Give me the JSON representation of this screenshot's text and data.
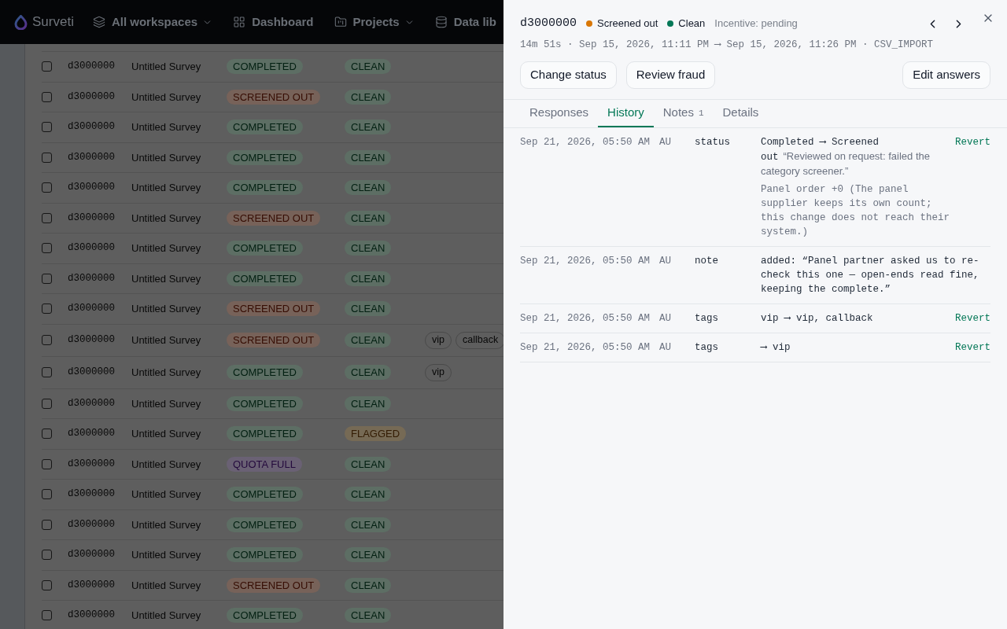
{
  "nav": {
    "brand": "Surveti",
    "items": [
      {
        "label": "All workspaces",
        "has_menu": true
      },
      {
        "label": "Dashboard",
        "has_menu": false
      },
      {
        "label": "Projects",
        "has_menu": true
      },
      {
        "label": "Data lib",
        "has_menu": false
      }
    ]
  },
  "table": {
    "rows": [
      {
        "checked": false,
        "id": "d3000000",
        "survey": "Untitled Survey",
        "status": {
          "label": "COMPLETED",
          "kind": "completed"
        },
        "fraud": {
          "label": "CLEAN",
          "kind": "clean"
        }
      },
      {
        "checked": false,
        "id": "d3000000",
        "survey": "Untitled Survey",
        "status": {
          "label": "SCREENED OUT",
          "kind": "screened_out"
        },
        "fraud": {
          "label": "CLEAN",
          "kind": "clean"
        }
      },
      {
        "checked": false,
        "id": "d3000000",
        "survey": "Untitled Survey",
        "status": {
          "label": "COMPLETED",
          "kind": "completed"
        },
        "fraud": {
          "label": "CLEAN",
          "kind": "clean"
        }
      },
      {
        "checked": false,
        "id": "d3000000",
        "survey": "Untitled Survey",
        "status": {
          "label": "COMPLETED",
          "kind": "completed"
        },
        "fraud": {
          "label": "CLEAN",
          "kind": "clean"
        }
      },
      {
        "checked": false,
        "id": "d3000000",
        "survey": "Untitled Survey",
        "status": {
          "label": "COMPLETED",
          "kind": "completed"
        },
        "fraud": {
          "label": "CLEAN",
          "kind": "clean"
        }
      },
      {
        "checked": false,
        "id": "d3000000",
        "survey": "Untitled Survey",
        "status": {
          "label": "SCREENED OUT",
          "kind": "screened_out"
        },
        "fraud": {
          "label": "CLEAN",
          "kind": "clean"
        }
      },
      {
        "checked": false,
        "id": "d3000000",
        "survey": "Untitled Survey",
        "status": {
          "label": "COMPLETED",
          "kind": "completed"
        },
        "fraud": {
          "label": "CLEAN",
          "kind": "clean"
        }
      },
      {
        "checked": false,
        "id": "d3000000",
        "survey": "Untitled Survey",
        "status": {
          "label": "COMPLETED",
          "kind": "completed"
        },
        "fraud": {
          "label": "CLEAN",
          "kind": "clean"
        }
      },
      {
        "checked": false,
        "id": "d3000000",
        "survey": "Untitled Survey",
        "status": {
          "label": "SCREENED OUT",
          "kind": "screened_out"
        },
        "fraud": {
          "label": "CLEAN",
          "kind": "clean"
        }
      },
      {
        "checked": false,
        "id": "d3000000",
        "survey": "Untitled Survey",
        "status": {
          "label": "SCREENED OUT",
          "kind": "screened_out"
        },
        "fraud": {
          "label": "CLEAN",
          "kind": "clean"
        },
        "tags": [
          "vip",
          "callback"
        ]
      },
      {
        "checked": false,
        "id": "d3000000",
        "survey": "Untitled Survey",
        "status": {
          "label": "COMPLETED",
          "kind": "completed"
        },
        "fraud": {
          "label": "CLEAN",
          "kind": "clean"
        },
        "tags": [
          "vip"
        ]
      },
      {
        "checked": false,
        "id": "d3000000",
        "survey": "Untitled Survey",
        "status": {
          "label": "COMPLETED",
          "kind": "completed"
        },
        "fraud": {
          "label": "CLEAN",
          "kind": "clean"
        }
      },
      {
        "checked": false,
        "id": "d3000000",
        "survey": "Untitled Survey",
        "status": {
          "label": "COMPLETED",
          "kind": "completed"
        },
        "fraud": {
          "label": "FLAGGED",
          "kind": "flagged"
        }
      },
      {
        "checked": false,
        "id": "d3000000",
        "survey": "Untitled Survey",
        "status": {
          "label": "QUOTA FULL",
          "kind": "quota_full"
        },
        "fraud": {
          "label": "CLEAN",
          "kind": "clean"
        }
      },
      {
        "checked": false,
        "id": "d3000000",
        "survey": "Untitled Survey",
        "status": {
          "label": "COMPLETED",
          "kind": "completed"
        },
        "fraud": {
          "label": "CLEAN",
          "kind": "clean"
        }
      },
      {
        "checked": false,
        "id": "d3000000",
        "survey": "Untitled Survey",
        "status": {
          "label": "COMPLETED",
          "kind": "completed"
        },
        "fraud": {
          "label": "CLEAN",
          "kind": "clean"
        }
      },
      {
        "checked": false,
        "id": "d3000000",
        "survey": "Untitled Survey",
        "status": {
          "label": "COMPLETED",
          "kind": "completed"
        },
        "fraud": {
          "label": "CLEAN",
          "kind": "clean"
        }
      },
      {
        "checked": false,
        "id": "d3000000",
        "survey": "Untitled Survey",
        "status": {
          "label": "SCREENED OUT",
          "kind": "screened_out"
        },
        "fraud": {
          "label": "CLEAN",
          "kind": "clean"
        }
      },
      {
        "checked": false,
        "id": "d3000000",
        "survey": "Untitled Survey",
        "status": {
          "label": "COMPLETED",
          "kind": "completed"
        },
        "fraud": {
          "label": "CLEAN",
          "kind": "clean"
        }
      }
    ]
  },
  "panel": {
    "id": "d3000000",
    "status": {
      "label": "Screened out",
      "color": "#d97706"
    },
    "fraud": {
      "label": "Clean",
      "color": "#047857"
    },
    "incentive": "Incentive: pending",
    "meta": "14m 51s · Sep 15, 2026, 11:11 PM ⟶ Sep 15, 2026, 11:26 PM · CSV_IMPORT",
    "actions_left": [
      "Change status",
      "Review fraud"
    ],
    "actions_right": [
      "Edit answers"
    ],
    "tabs": [
      {
        "label": "Responses",
        "selected": false
      },
      {
        "label": "History",
        "selected": true
      },
      {
        "label": "Notes",
        "count": "1",
        "selected": false
      },
      {
        "label": "Details",
        "selected": false
      }
    ],
    "history": [
      {
        "date": "Sep 21, 2026, 05:50 AM",
        "actor": "AU",
        "field": "status",
        "change": "Completed ⟶ Screened out",
        "comment": "“Reviewed on request: failed the category screener.”",
        "detail": "Panel order +0 (The panel supplier keeps its own count; this change does not reach their system.)",
        "action": "Revert"
      },
      {
        "date": "Sep 21, 2026, 05:50 AM",
        "actor": "AU",
        "field": "note",
        "change": "added: “Panel partner asked us to re-check this one — open-ends read fine, keeping the complete.”"
      },
      {
        "date": "Sep 21, 2026, 05:50 AM",
        "actor": "AU",
        "field": "tags",
        "change": "vip ⟶ vip, callback",
        "action": "Revert"
      },
      {
        "date": "Sep 21, 2026, 05:50 AM",
        "actor": "AU",
        "field": "tags",
        "change": "⟶ vip",
        "action": "Revert"
      }
    ]
  }
}
